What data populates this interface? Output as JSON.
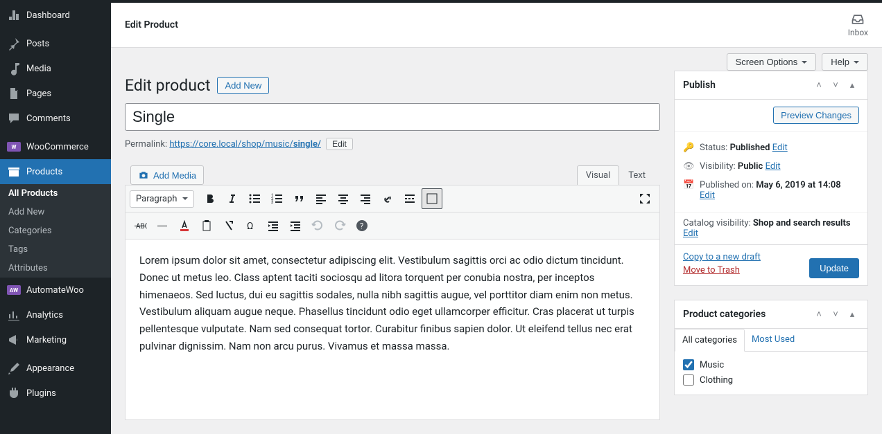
{
  "header": {
    "title": "Edit Product",
    "inbox": "Inbox"
  },
  "top_buttons": {
    "screen_options": "Screen Options",
    "help": "Help"
  },
  "page": {
    "title": "Edit product",
    "add_new": "Add New"
  },
  "title_input": {
    "value": "Single"
  },
  "permalink": {
    "label": "Permalink:",
    "base": "https://core.local/shop/music/",
    "slug": "single/",
    "edit": "Edit"
  },
  "media": {
    "add": "Add Media"
  },
  "editor_tabs": {
    "visual": "Visual",
    "text": "Text"
  },
  "format": {
    "label": "Paragraph"
  },
  "content": {
    "body": "Lorem ipsum dolor sit amet, consectetur adipiscing elit. Vestibulum sagittis orci ac odio dictum tincidunt. Donec ut metus leo. Class aptent taciti sociosqu ad litora torquent per conubia nostra, per inceptos himenaeos. Sed luctus, dui eu sagittis sodales, nulla nibh sagittis augue, vel porttitor diam enim non metus. Vestibulum aliquam augue neque. Phasellus tincidunt odio eget ullamcorper efficitur. Cras placerat ut turpis pellentesque vulputate. Nam sed consequat tortor. Curabitur finibus sapien dolor. Ut eleifend tellus nec erat pulvinar dignissim. Nam non arcu purus. Vivamus et massa massa."
  },
  "sidebar": {
    "items": [
      {
        "label": "Dashboard"
      },
      {
        "label": "Posts"
      },
      {
        "label": "Media"
      },
      {
        "label": "Pages"
      },
      {
        "label": "Comments"
      },
      {
        "label": "WooCommerce"
      },
      {
        "label": "Products"
      },
      {
        "label": "AutomateWoo"
      },
      {
        "label": "Analytics"
      },
      {
        "label": "Marketing"
      },
      {
        "label": "Appearance"
      },
      {
        "label": "Plugins"
      }
    ],
    "sub": [
      {
        "label": "All Products"
      },
      {
        "label": "Add New"
      },
      {
        "label": "Categories"
      },
      {
        "label": "Tags"
      },
      {
        "label": "Attributes"
      }
    ]
  },
  "publish": {
    "title": "Publish",
    "preview": "Preview Changes",
    "status_label": "Status:",
    "status_value": "Published",
    "edit": "Edit",
    "visibility_label": "Visibility:",
    "visibility_value": "Public",
    "published_label": "Published on:",
    "published_value": "May 6, 2019 at 14:08",
    "catalog_label": "Catalog visibility:",
    "catalog_value": "Shop and search results",
    "copy": "Copy to a new draft",
    "trash": "Move to Trash",
    "update": "Update"
  },
  "product_cats": {
    "title": "Product categories",
    "tab_all": "All categories",
    "tab_most": "Most Used",
    "items": [
      {
        "label": "Music",
        "checked": true
      },
      {
        "label": "Clothing",
        "checked": false
      }
    ]
  }
}
